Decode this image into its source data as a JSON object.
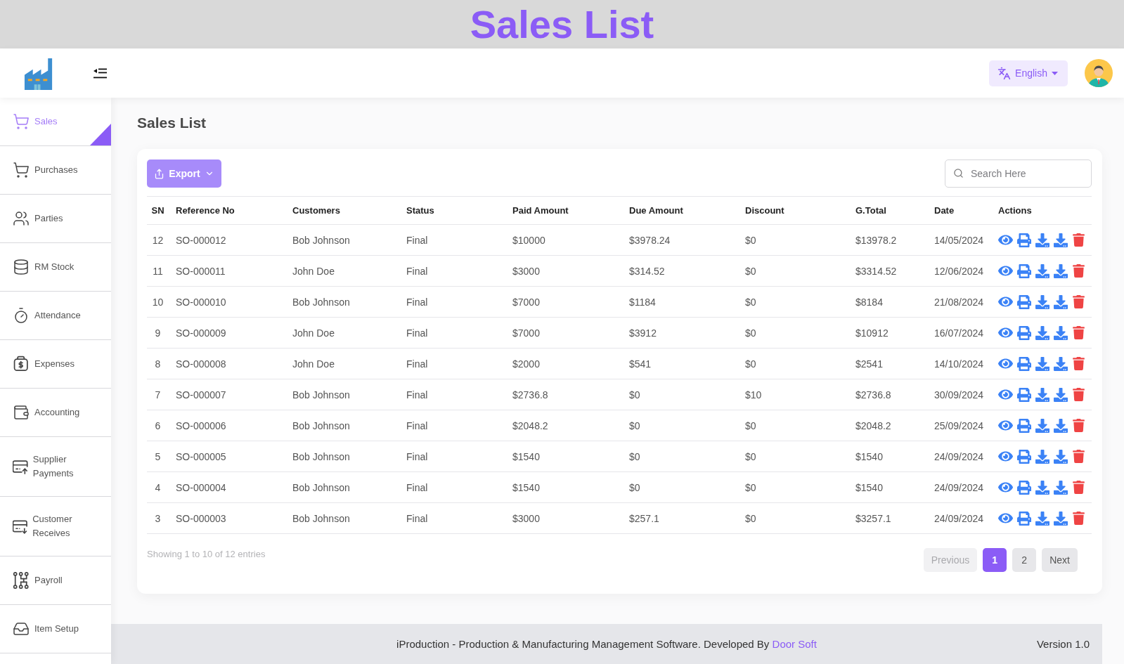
{
  "banner": {
    "title": "Sales List"
  },
  "header": {
    "language": "English"
  },
  "sidebar": {
    "items": [
      {
        "label": "Sales",
        "selected": true
      },
      {
        "label": "Purchases",
        "selected": false
      },
      {
        "label": "Parties",
        "selected": false
      },
      {
        "label": "RM Stock",
        "selected": false
      },
      {
        "label": "Attendance",
        "selected": false
      },
      {
        "label": "Expenses",
        "selected": false
      },
      {
        "label": "Accounting",
        "selected": false
      },
      {
        "label": "Supplier Payments",
        "selected": false
      },
      {
        "label": "Customer Receives",
        "selected": false
      },
      {
        "label": "Payroll",
        "selected": false
      },
      {
        "label": "Item Setup",
        "selected": false
      }
    ]
  },
  "page": {
    "title": "Sales List"
  },
  "toolbar": {
    "export_label": "Export",
    "search": {
      "placeholder": "Search Here"
    }
  },
  "table": {
    "columns": [
      "SN",
      "Reference No",
      "Customers",
      "Status",
      "Paid Amount",
      "Due Amount",
      "Discount",
      "G.Total",
      "Date",
      "Actions"
    ],
    "rows": [
      {
        "sn": "12",
        "reference_no": "SO-000012",
        "customer": "Bob Johnson",
        "status": "Final",
        "paid_amount": "$10000",
        "due_amount": "$3978.24",
        "discount": "$0",
        "g_total": "$13978.2",
        "date": "14/05/2024"
      },
      {
        "sn": "11",
        "reference_no": "SO-000011",
        "customer": "John Doe",
        "status": "Final",
        "paid_amount": "$3000",
        "due_amount": "$314.52",
        "discount": "$0",
        "g_total": "$3314.52",
        "date": "12/06/2024"
      },
      {
        "sn": "10",
        "reference_no": "SO-000010",
        "customer": "Bob Johnson",
        "status": "Final",
        "paid_amount": "$7000",
        "due_amount": "$1184",
        "discount": "$0",
        "g_total": "$8184",
        "date": "21/08/2024"
      },
      {
        "sn": "9",
        "reference_no": "SO-000009",
        "customer": "John Doe",
        "status": "Final",
        "paid_amount": "$7000",
        "due_amount": "$3912",
        "discount": "$0",
        "g_total": "$10912",
        "date": "16/07/2024"
      },
      {
        "sn": "8",
        "reference_no": "SO-000008",
        "customer": "John Doe",
        "status": "Final",
        "paid_amount": "$2000",
        "due_amount": "$541",
        "discount": "$0",
        "g_total": "$2541",
        "date": "14/10/2024"
      },
      {
        "sn": "7",
        "reference_no": "SO-000007",
        "customer": "Bob Johnson",
        "status": "Final",
        "paid_amount": "$2736.8",
        "due_amount": "$0",
        "discount": "$10",
        "g_total": "$2736.8",
        "date": "30/09/2024"
      },
      {
        "sn": "6",
        "reference_no": "SO-000006",
        "customer": "Bob Johnson",
        "status": "Final",
        "paid_amount": "$2048.2",
        "due_amount": "$0",
        "discount": "$0",
        "g_total": "$2048.2",
        "date": "25/09/2024"
      },
      {
        "sn": "5",
        "reference_no": "SO-000005",
        "customer": "Bob Johnson",
        "status": "Final",
        "paid_amount": "$1540",
        "due_amount": "$0",
        "discount": "$0",
        "g_total": "$1540",
        "date": "24/09/2024"
      },
      {
        "sn": "4",
        "reference_no": "SO-000004",
        "customer": "Bob Johnson",
        "status": "Final",
        "paid_amount": "$1540",
        "due_amount": "$0",
        "discount": "$0",
        "g_total": "$1540",
        "date": "24/09/2024"
      },
      {
        "sn": "3",
        "reference_no": "SO-000003",
        "customer": "Bob Johnson",
        "status": "Final",
        "paid_amount": "$3000",
        "due_amount": "$257.1",
        "discount": "$0",
        "g_total": "$3257.1",
        "date": "24/09/2024"
      }
    ]
  },
  "pagination": {
    "summary": "Showing 1 to 10 of 12 entries",
    "previous": {
      "label": "Previous",
      "disabled": true
    },
    "pages": [
      {
        "label": "1",
        "selected": true
      },
      {
        "label": "2",
        "selected": false
      }
    ],
    "next": {
      "label": "Next",
      "disabled": false
    }
  },
  "footer": {
    "text": "iProduction - Production & Manufacturing Management Software. Developed By",
    "link": "Door Soft",
    "version": "Version 1.0"
  }
}
